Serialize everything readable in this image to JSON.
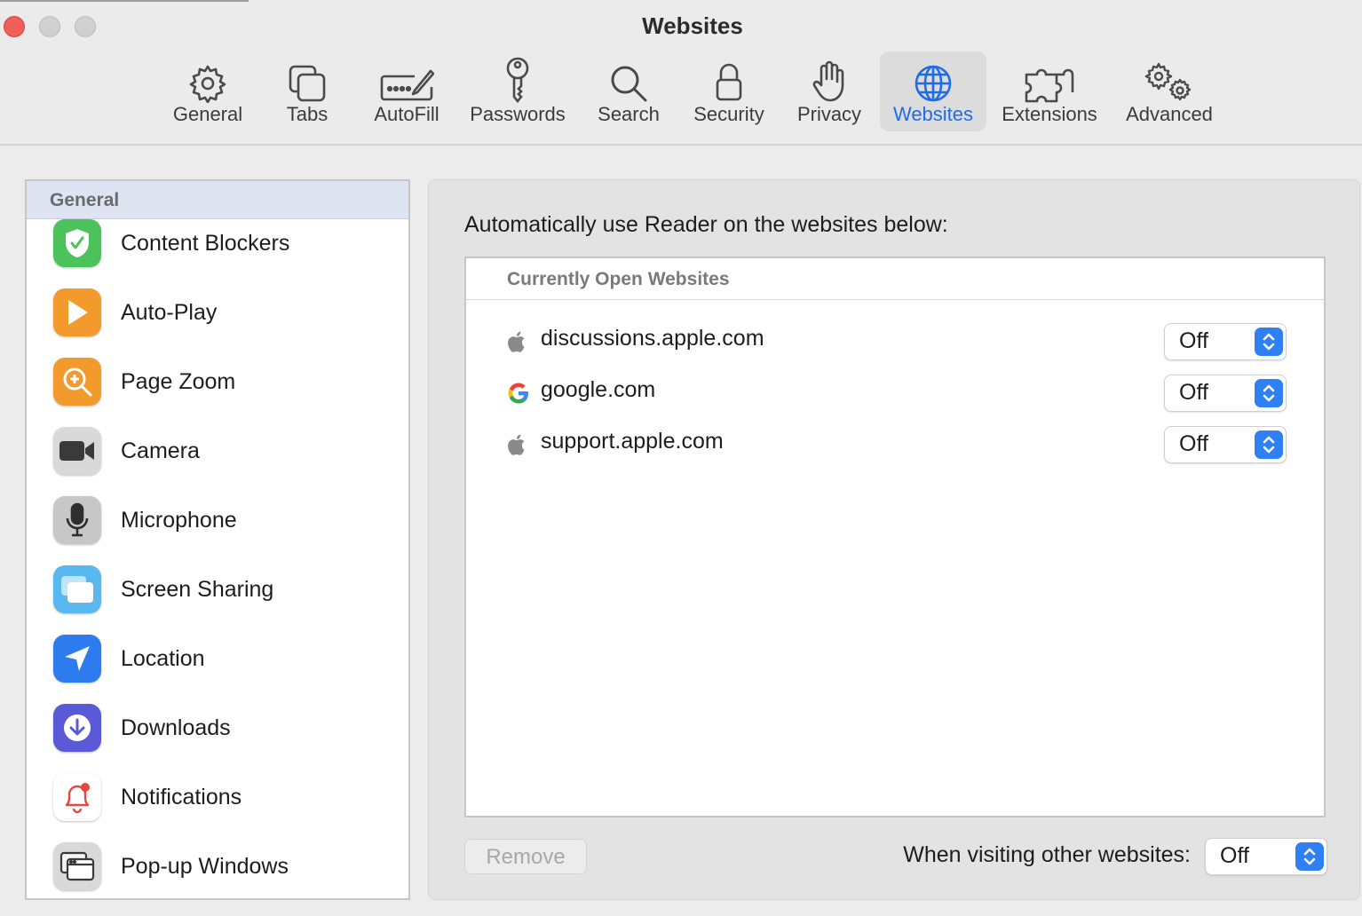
{
  "window": {
    "title": "Websites"
  },
  "tabs": [
    {
      "id": "general",
      "label": "General",
      "icon": "gear-icon"
    },
    {
      "id": "tabs",
      "label": "Tabs",
      "icon": "tabs-icon"
    },
    {
      "id": "autofill",
      "label": "AutoFill",
      "icon": "pencil-field-icon"
    },
    {
      "id": "passwords",
      "label": "Passwords",
      "icon": "key-icon"
    },
    {
      "id": "search",
      "label": "Search",
      "icon": "magnifier-icon"
    },
    {
      "id": "security",
      "label": "Security",
      "icon": "lock-icon"
    },
    {
      "id": "privacy",
      "label": "Privacy",
      "icon": "hand-icon"
    },
    {
      "id": "websites",
      "label": "Websites",
      "icon": "globe-icon",
      "active": true
    },
    {
      "id": "extensions",
      "label": "Extensions",
      "icon": "puzzle-icon"
    },
    {
      "id": "advanced",
      "label": "Advanced",
      "icon": "gears-icon"
    }
  ],
  "sidebar": {
    "header": "General",
    "items": [
      {
        "label": "Content Blockers",
        "icon": "shield-check-icon",
        "color": "#4cc35a"
      },
      {
        "label": "Auto-Play",
        "icon": "play-icon",
        "color": "#f39a2d"
      },
      {
        "label": "Page Zoom",
        "icon": "zoom-icon",
        "color": "#f39a2d"
      },
      {
        "label": "Camera",
        "icon": "camera-icon",
        "color": "#5f5f5f"
      },
      {
        "label": "Microphone",
        "icon": "microphone-icon",
        "color": "#a8a8a8"
      },
      {
        "label": "Screen Sharing",
        "icon": "screens-icon",
        "color": "#59b8f0"
      },
      {
        "label": "Location",
        "icon": "location-arrow-icon",
        "color": "#2c7bef"
      },
      {
        "label": "Downloads",
        "icon": "download-icon",
        "color": "#5a5ad8"
      },
      {
        "label": "Notifications",
        "icon": "bell-icon",
        "color": "#ffffff"
      },
      {
        "label": "Pop-up Windows",
        "icon": "popup-windows-icon",
        "color": "#d9d9d9"
      }
    ]
  },
  "main": {
    "description": "Automatically use Reader on the websites below:",
    "list_header": "Currently Open Websites",
    "sites": [
      {
        "name": "discussions.apple.com",
        "favicon": "apple-icon",
        "value": "Off"
      },
      {
        "name": "google.com",
        "favicon": "google-icon",
        "value": "Off"
      },
      {
        "name": "support.apple.com",
        "favicon": "apple-icon",
        "value": "Off"
      }
    ],
    "remove_label": "Remove",
    "other_label": "When visiting other websites:",
    "other_value": "Off"
  },
  "colors": {
    "accent": "#1e6ce8",
    "close": "#ee5f57"
  }
}
